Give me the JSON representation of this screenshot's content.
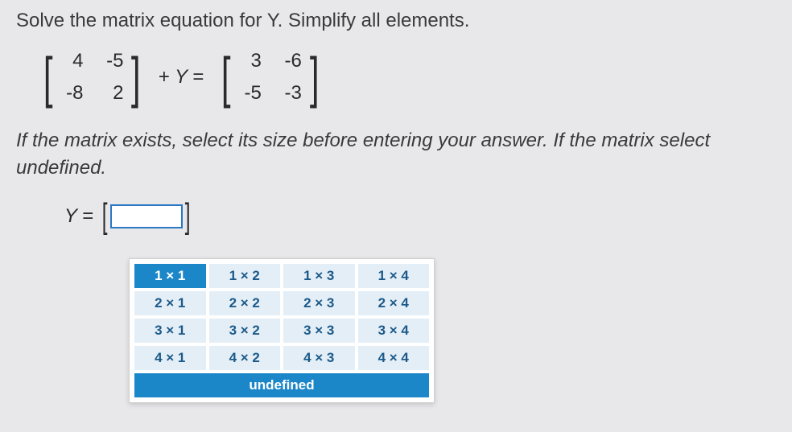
{
  "question": "Solve the matrix equation for Y. Simplify all elements.",
  "equation": {
    "matrixA": [
      [
        "4",
        "-5"
      ],
      [
        "-8",
        "2"
      ]
    ],
    "middle_plus": "+",
    "middle_var": "Y",
    "middle_eq": "=",
    "matrixB": [
      [
        "3",
        "-6"
      ],
      [
        "-5",
        "-3"
      ]
    ]
  },
  "instruction": "If the matrix exists, select its size before entering your answer. If the matrix select undefined.",
  "answer": {
    "label_var": "Y",
    "label_eq": "="
  },
  "size_options": {
    "rows": [
      [
        {
          "label": "1 × 1",
          "light": false
        },
        {
          "label": "1 × 2",
          "light": true
        },
        {
          "label": "1 × 3",
          "light": true
        },
        {
          "label": "1 × 4",
          "light": true
        }
      ],
      [
        {
          "label": "2 × 1",
          "light": true
        },
        {
          "label": "2 × 2",
          "light": true
        },
        {
          "label": "2 × 3",
          "light": true
        },
        {
          "label": "2 × 4",
          "light": true
        }
      ],
      [
        {
          "label": "3 × 1",
          "light": true
        },
        {
          "label": "3 × 2",
          "light": true
        },
        {
          "label": "3 × 3",
          "light": true
        },
        {
          "label": "3 × 4",
          "light": true
        }
      ],
      [
        {
          "label": "4 × 1",
          "light": true
        },
        {
          "label": "4 × 2",
          "light": true
        },
        {
          "label": "4 × 3",
          "light": true
        },
        {
          "label": "4 × 4",
          "light": true
        }
      ]
    ],
    "undefined_label": "undefined"
  }
}
